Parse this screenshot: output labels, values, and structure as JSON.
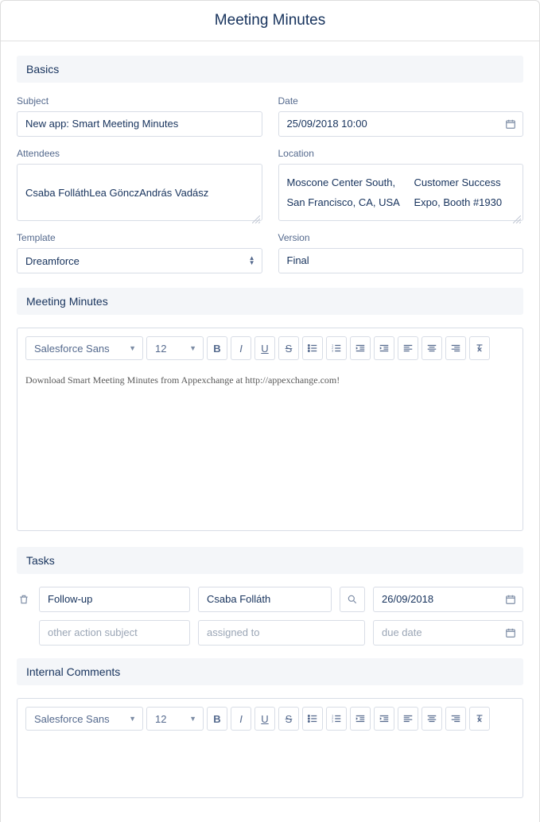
{
  "pageTitle": "Meeting Minutes",
  "sections": {
    "basics": "Basics",
    "minutes": "Meeting Minutes",
    "tasks": "Tasks",
    "internalComments": "Internal Comments"
  },
  "labels": {
    "subject": "Subject",
    "date": "Date",
    "attendees": "Attendees",
    "location": "Location",
    "template": "Template",
    "version": "Version"
  },
  "basics": {
    "subject": "New app: Smart Meeting Minutes",
    "date": "25/09/2018 10:00",
    "attendees": [
      "Csaba Folláth",
      "Lea Göncz",
      "András Vadász"
    ],
    "locationLine1": "Moscone Center South, San Francisco, CA, USA",
    "locationLine2": "Customer Success Expo, Booth #1930",
    "template": "Dreamforce",
    "version": "Final"
  },
  "rte": {
    "font": "Salesforce Sans",
    "fontSize": "12",
    "meetingMinutesBody": "Download Smart Meeting Minutes from Appexchange at http://appexchange.com!",
    "internalCommentsBody": ""
  },
  "tasks": [
    {
      "subject": "Follow-up",
      "subjectPlaceholder": "other action subject",
      "assignedTo": "Csaba Folláth",
      "assignedToPlaceholder": "assigned to",
      "dueDate": "26/09/2018",
      "dueDatePlaceholder": "due date",
      "hasDelete": true,
      "hasLookup": true
    },
    {
      "subject": "",
      "subjectPlaceholder": "other action subject",
      "assignedTo": "",
      "assignedToPlaceholder": "assigned to",
      "dueDate": "",
      "dueDatePlaceholder": "due date",
      "hasDelete": false,
      "hasLookup": false
    }
  ]
}
